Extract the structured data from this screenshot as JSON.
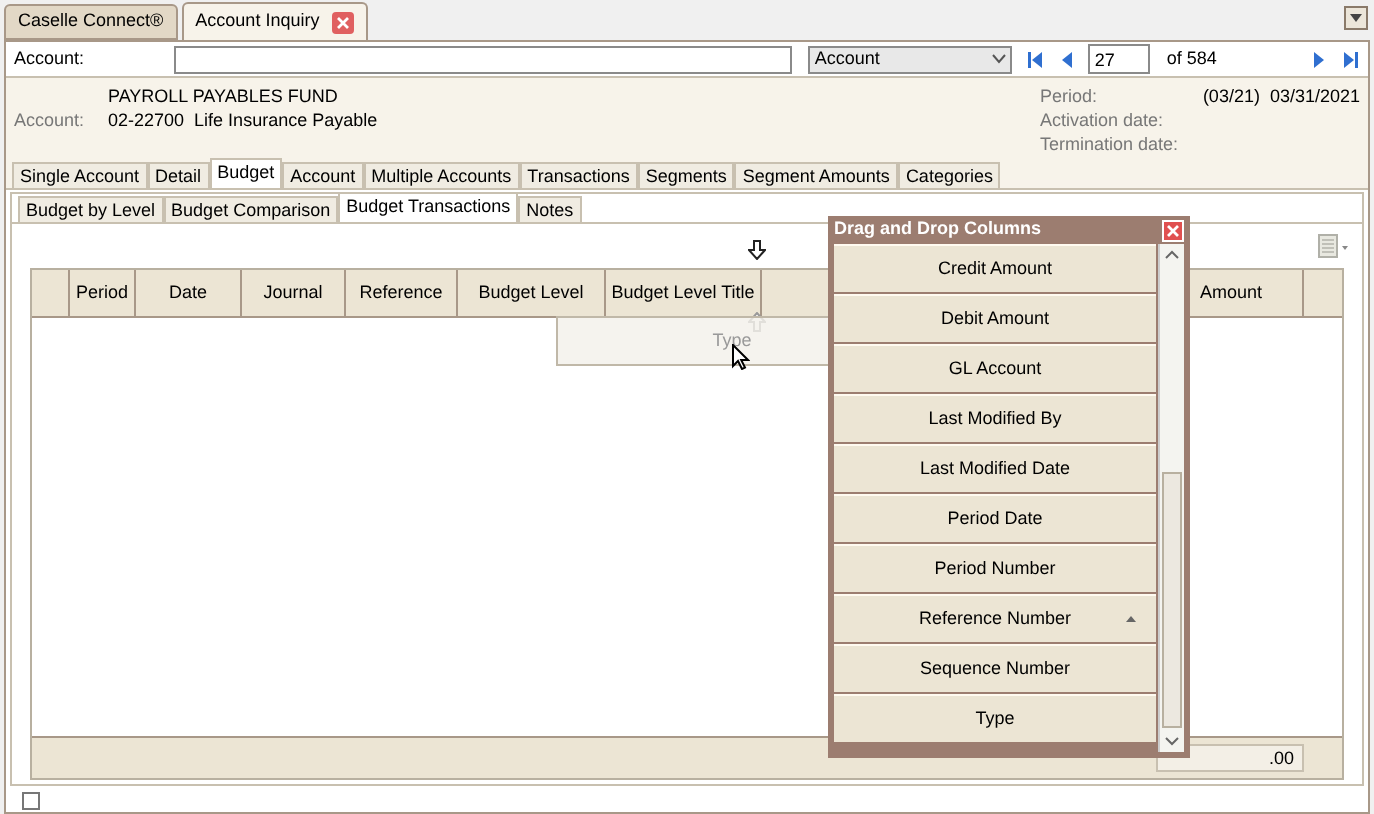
{
  "doc_tabs": [
    {
      "label": "Caselle Connect®",
      "selected": false,
      "closable": false
    },
    {
      "label": "Account Inquiry",
      "selected": true,
      "closable": true
    }
  ],
  "lookup": {
    "label": "Account:",
    "search_by": "Account",
    "record": "27",
    "record_count": "of 584"
  },
  "account_info": {
    "fund": "PAYROLL PAYABLES FUND",
    "label": "Account:",
    "number": "02-22700",
    "description": "Life Insurance Payable",
    "fields": [
      {
        "label": "Period:",
        "value": "(03/21)  03/31/2021"
      },
      {
        "label": "Activation date:"
      },
      {
        "label": "Termination date:"
      }
    ]
  },
  "tabs": [
    {
      "label": "Single Account",
      "selected": false
    },
    {
      "label": "Detail",
      "selected": false
    },
    {
      "label": "Budget",
      "selected": true
    },
    {
      "label": "Account",
      "selected": false
    },
    {
      "label": "Multiple Accounts",
      "selected": false
    },
    {
      "label": "Transactions",
      "selected": false
    },
    {
      "label": "Segments",
      "selected": false
    },
    {
      "label": "Segment Amounts",
      "selected": false
    },
    {
      "label": "Categories",
      "selected": false
    }
  ],
  "subtabs": [
    {
      "label": "Budget by Level",
      "selected": false
    },
    {
      "label": "Budget Comparison",
      "selected": false
    },
    {
      "label": "Budget Transactions",
      "selected": true
    },
    {
      "label": "Notes",
      "selected": false
    }
  ],
  "grid": {
    "columns": [
      "Period",
      "Date",
      "Journal",
      "Reference",
      "Budget Level",
      "Budget Level Title"
    ],
    "right_columns": [
      "Amount"
    ],
    "total": ".00"
  },
  "dragged_column": "Type",
  "bottom_checkbox": {
    "checked": false
  },
  "column_chooser": {
    "title": "Drag and Drop Columns",
    "items": [
      {
        "label": "Credit Amount",
        "sorted": false
      },
      {
        "label": "Debit Amount",
        "sorted": false
      },
      {
        "label": "GL Account",
        "sorted": false
      },
      {
        "label": "Last Modified By",
        "sorted": false
      },
      {
        "label": "Last Modified Date",
        "sorted": false
      },
      {
        "label": "Period Date",
        "sorted": false
      },
      {
        "label": "Period Number",
        "sorted": false
      },
      {
        "label": "Reference Number",
        "sorted": true
      },
      {
        "label": "Sequence Number",
        "sorted": false
      },
      {
        "label": "Type",
        "sorted": false
      }
    ]
  }
}
